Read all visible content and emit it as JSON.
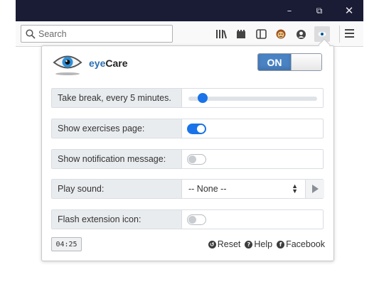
{
  "window": {
    "controls": {
      "minimize": "–",
      "maximize": "⧉",
      "close": "✕"
    }
  },
  "toolbar": {
    "search_placeholder": "Search",
    "icons": [
      "search-icon",
      "library-icon",
      "screenshot-icon",
      "sidebar-icon",
      "monkey-extension-icon",
      "account-icon",
      "eyecare-extension-icon",
      "menu-icon"
    ]
  },
  "popup": {
    "app_name_prefix": "eye",
    "app_name_suffix": "Care",
    "power": {
      "on_label": "ON",
      "state": "on"
    },
    "settings": [
      {
        "label": "Take break, every 5 minutes.",
        "type": "slider",
        "value_fraction": 0.11
      },
      {
        "label": "Show exercises page:",
        "type": "toggle",
        "checked": true
      },
      {
        "label": "Show notification message:",
        "type": "toggle",
        "checked": false
      },
      {
        "label": "Play sound:",
        "type": "select",
        "selected": "-- None --"
      },
      {
        "label": "Flash extension icon:",
        "type": "toggle",
        "checked": false
      }
    ],
    "timer": "04:25",
    "footer_links": [
      {
        "label": "Reset",
        "icon": "reset-icon"
      },
      {
        "label": "Help",
        "icon": "help-icon"
      },
      {
        "label": "Facebook",
        "icon": "facebook-icon"
      }
    ]
  },
  "colors": {
    "titlebar": "#1a1b34",
    "accent": "#1a73e8",
    "on_button": "#4a83c4"
  }
}
